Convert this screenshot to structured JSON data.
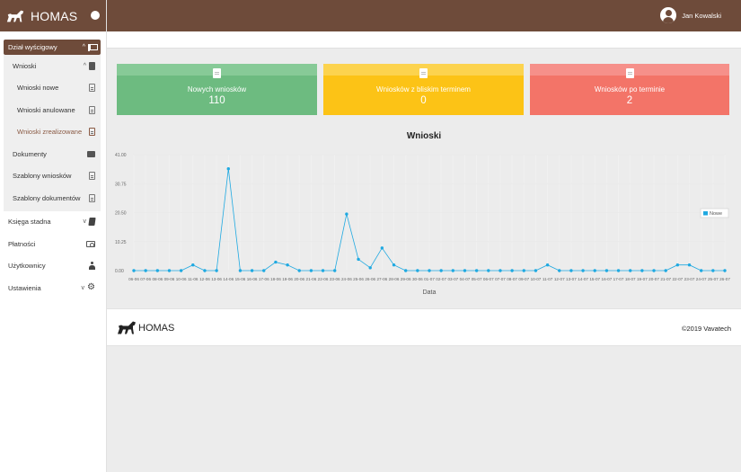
{
  "brand": {
    "name": "HOMAS"
  },
  "header": {
    "user_name": "Jan Kowalski"
  },
  "sidebar": {
    "section": "Dział wyścigowy",
    "group": "Wnioski",
    "group_items": [
      "Wnioski nowe",
      "Wnioski anulowane",
      "Wnioski zrealizowane"
    ],
    "section_items": [
      "Dokumenty",
      "Szablony wniosków",
      "Szablony dokumentów"
    ],
    "main_items": [
      "Księga stadna",
      "Płatności",
      "Użytkownicy",
      "Ustawienia"
    ]
  },
  "cards": [
    {
      "label": "Nowych wniosków",
      "value": "110",
      "color": "#6dbb80"
    },
    {
      "label": "Wniosków z bliskim terminem",
      "value": "0",
      "color": "#fcc316"
    },
    {
      "label": "Wniosków po terminie",
      "value": "2",
      "color": "#f37468"
    }
  ],
  "chart_title": "Wnioski",
  "chart_data": {
    "type": "line",
    "title": "Wnioski",
    "xlabel": "Data",
    "ylabel": "",
    "ylim": [
      0,
      41
    ],
    "yticks": [
      "0.00",
      "10.25",
      "20.50",
      "30.75",
      "41.00"
    ],
    "legend_position": "right",
    "grid": true,
    "x": [
      "06-06",
      "07-06",
      "08-06",
      "09-06",
      "10-06",
      "11-06",
      "12-06",
      "13-06",
      "14-06",
      "15-06",
      "16-06",
      "17-06",
      "18-06",
      "19-06",
      "20-06",
      "21-06",
      "22-06",
      "23-06",
      "24-06",
      "25-06",
      "26-06",
      "27-06",
      "28-06",
      "29-06",
      "30-06",
      "01-07",
      "02-07",
      "03-07",
      "04-07",
      "05-07",
      "06-07",
      "07-07",
      "08-07",
      "09-07",
      "10-07",
      "11-07",
      "12-07",
      "13-07",
      "14-07",
      "15-07",
      "16-07",
      "17-07",
      "18-07",
      "19-07",
      "20-07",
      "21-07",
      "22-07",
      "23-07",
      "24-07",
      "25-07",
      "26-07"
    ],
    "xtick_labels": [
      "06-06",
      "07-06",
      "08-06",
      "09-06",
      "10-06",
      "11-06",
      "12-06",
      "13-06",
      "14-06",
      "15-06",
      "16-06",
      "17-06",
      "18-06",
      "19-06",
      "20-06",
      "21-06",
      "22-06",
      "23-06",
      "24-06",
      "25-06",
      "26-06",
      "27-06",
      "28-06",
      "29-06",
      "30-06",
      "01-07",
      "02-07",
      "03-07",
      "04-07",
      "05-07",
      "06-07",
      "07-07",
      "08-07",
      "09-07",
      "10-07",
      "11-07",
      "12-07",
      "13-07",
      "14-07",
      "15-07",
      "16-07",
      "17-07",
      "18-07",
      "19-07",
      "20-07",
      "21-07",
      "22-07",
      "23-07",
      "24-07",
      "25-07",
      "26-07"
    ],
    "series": [
      {
        "name": "Nowe",
        "color": "#1fa9e1",
        "values": [
          0,
          0,
          0,
          0,
          0,
          2,
          0,
          0,
          36,
          0,
          0,
          0,
          3,
          2,
          0,
          0,
          0,
          0,
          20,
          4,
          1,
          8,
          2,
          0,
          0,
          0,
          0,
          0,
          0,
          0,
          0,
          0,
          0,
          0,
          0,
          2,
          0,
          0,
          0,
          0,
          0,
          0,
          0,
          0,
          0,
          0,
          2,
          2,
          0,
          0,
          0
        ]
      }
    ]
  },
  "footer": {
    "brand": "HOMAS",
    "copyright": "©2019 Vavatech"
  }
}
